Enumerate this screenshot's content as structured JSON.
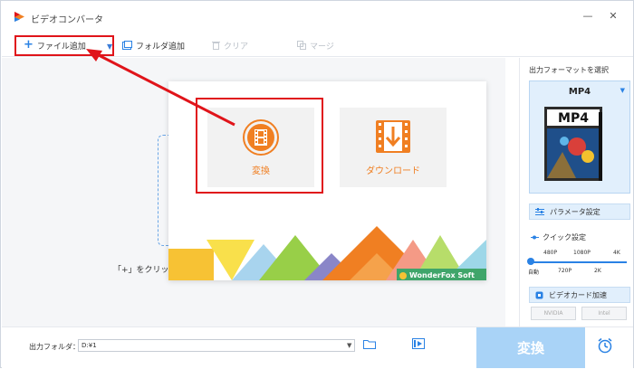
{
  "app": {
    "title": "ビデオコンバータ"
  },
  "window_buttons": {
    "minimize": "—",
    "close": "✕"
  },
  "toolbar": {
    "add_file": "ファイル追加",
    "add_folder": "フォルダ追加",
    "clear": "クリア",
    "merge": "マージ"
  },
  "main": {
    "hint": "「+」をクリックし"
  },
  "popup": {
    "convert_label": "変換",
    "download_label": "ダウンロード",
    "brand": "WonderFox Soft"
  },
  "right_panel": {
    "title": "出力フォーマットを選択",
    "format": "MP4",
    "format_thumb_label": "MP4",
    "param_button": "パラメータ設定",
    "quick_title": "クイック設定",
    "ticks_top": [
      "480P",
      "1080P",
      "4K"
    ],
    "ticks_bottom": [
      "自動",
      "720P",
      "2K"
    ],
    "gpu_button": "ビデオカード加速",
    "gpu_nvidia": "NVIDIA",
    "gpu_intel": "Intel"
  },
  "bottom": {
    "output_label": "出力フォルダ：",
    "output_path": "D:¥1",
    "convert_button": "変換"
  },
  "colors": {
    "accent_blue": "#2a82e4",
    "orange": "#f07f22",
    "highlight_red": "#e0141a",
    "convert_btn": "#a9d3f7"
  }
}
